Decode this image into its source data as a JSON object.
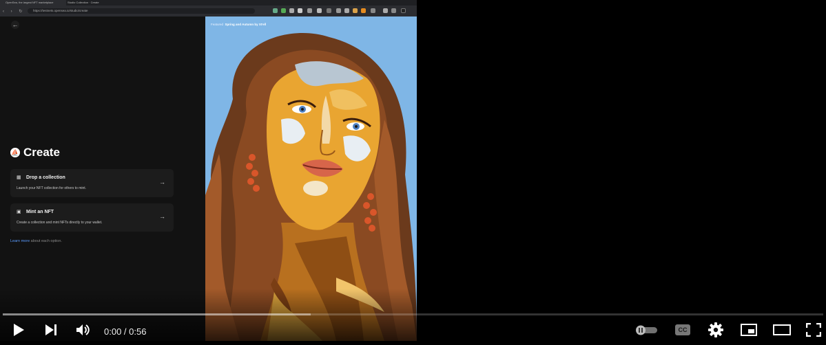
{
  "browser": {
    "tabs": [
      "OpenSea, the largest NFT marketplace",
      "Studio Collection · Create"
    ],
    "url": "https://testnets.opensea.io/studio/create"
  },
  "page": {
    "title": "Create",
    "options": [
      {
        "title": "Drop a collection",
        "description": "Launch your NFT collection for others to mint."
      },
      {
        "title": "Mint an NFT",
        "description": "Create a collection and mint NFTs directly to your wallet."
      }
    ],
    "learn_more_link": "Learn more",
    "learn_more_suffix": " about each option."
  },
  "artwork": {
    "featured_label": "Featured",
    "featured_title": "Spring and Autumn by XI'ell"
  },
  "player": {
    "current_time": "0:00",
    "separator": " / ",
    "duration": "0:56",
    "played_fraction": 0.0,
    "buffered_fraction": 0.375,
    "autoplay": false,
    "icons": [
      "play-icon",
      "next-icon",
      "volume-icon",
      "autoplay-toggle-icon",
      "captions-icon",
      "settings-icon",
      "miniplayer-icon",
      "theater-icon",
      "fullscreen-icon"
    ],
    "captions_label": "CC"
  }
}
